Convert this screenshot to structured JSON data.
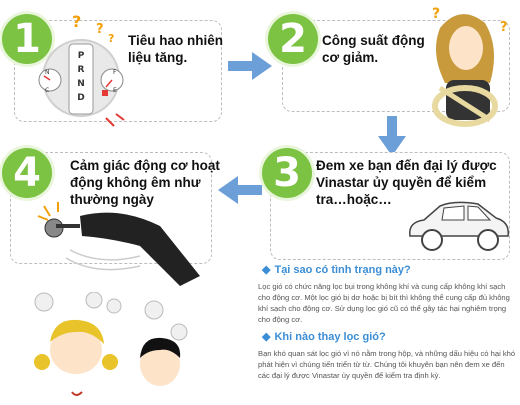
{
  "steps": [
    {
      "number": "1",
      "text_line1": "Tiêu hao nhiên",
      "text_line2": "liệu tăng."
    },
    {
      "number": "2",
      "text_line1": "Công suất động",
      "text_line2": "cơ giảm."
    },
    {
      "number": "3",
      "text_line1": "Đem xe bạn đến đại lý được",
      "text_line2": "Vinastar ủy quyền để kiểm",
      "text_line3": "tra…hoặc…"
    },
    {
      "number": "4",
      "text_line1": "Cảm giác động cơ hoạt",
      "text_line2": "động không êm như",
      "text_line3": "thường ngày"
    }
  ],
  "gauge": {
    "gear_letters": [
      "P",
      "R",
      "N",
      "D"
    ],
    "left_labels": [
      "N",
      "C"
    ],
    "right_labels": [
      "F",
      "E"
    ]
  },
  "faq": [
    {
      "question": "Tại sao có tình trạng này?",
      "answer": "Lọc gió có chức năng lọc bụi trong không khí và cung cấp không khí sạch cho động cơ. Một lọc gió bị dơ hoặc bị bít thì không thể cung cấp đủ không khí sạch cho động cơ. Sử dụng lọc gió cũ có thể gây tác hại nghiêm trọng cho động cơ."
    },
    {
      "question": "Khi nào thay lọc gió?",
      "answer": "Bạn khó quan sát lọc gió vì nó nằm trong hộp, và những dấu hiệu có hại khó phát hiện vì chúng tiến triển từ từ. Chúng tôi khuyên bạn nên đem xe đến các đại lý được Vinastar ủy quyền để kiểm tra định kỳ."
    }
  ],
  "colors": {
    "accent_green": "#7cc243",
    "arrow_blue": "#6c9fd8",
    "question_mark": "#f2a10b",
    "faq_blue": "#3b8ed6"
  },
  "decor": {
    "question_mark": "?"
  }
}
